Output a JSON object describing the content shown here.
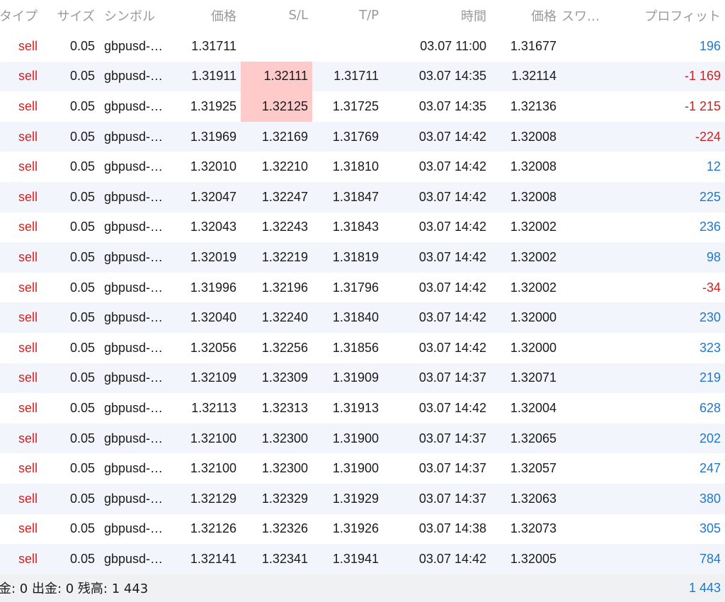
{
  "columns": {
    "type": "タイプ",
    "size": "サイズ",
    "symbol": "シンボル",
    "open_price": "価格",
    "sl": "S/L",
    "tp": "T/P",
    "time": "時間",
    "price": "価格",
    "swap": "スワ…",
    "profit": "プロフィット"
  },
  "rows": [
    {
      "type": "sell",
      "size": "0.05",
      "symbol": "gbpusd-…",
      "open_price": "1.31711",
      "sl": "",
      "tp": "",
      "time": "03.07 11:00",
      "price": "1.31677",
      "swap": "",
      "profit": "196",
      "profit_sign": "pos",
      "sl_hit": false
    },
    {
      "type": "sell",
      "size": "0.05",
      "symbol": "gbpusd-…",
      "open_price": "1.31911",
      "sl": "1.32111",
      "tp": "1.31711",
      "time": "03.07 14:35",
      "price": "1.32114",
      "swap": "",
      "profit": "-1 169",
      "profit_sign": "neg",
      "sl_hit": true
    },
    {
      "type": "sell",
      "size": "0.05",
      "symbol": "gbpusd-…",
      "open_price": "1.31925",
      "sl": "1.32125",
      "tp": "1.31725",
      "time": "03.07 14:35",
      "price": "1.32136",
      "swap": "",
      "profit": "-1 215",
      "profit_sign": "neg",
      "sl_hit": true
    },
    {
      "type": "sell",
      "size": "0.05",
      "symbol": "gbpusd-…",
      "open_price": "1.31969",
      "sl": "1.32169",
      "tp": "1.31769",
      "time": "03.07 14:42",
      "price": "1.32008",
      "swap": "",
      "profit": "-224",
      "profit_sign": "neg",
      "sl_hit": false
    },
    {
      "type": "sell",
      "size": "0.05",
      "symbol": "gbpusd-…",
      "open_price": "1.32010",
      "sl": "1.32210",
      "tp": "1.31810",
      "time": "03.07 14:42",
      "price": "1.32008",
      "swap": "",
      "profit": "12",
      "profit_sign": "pos",
      "sl_hit": false
    },
    {
      "type": "sell",
      "size": "0.05",
      "symbol": "gbpusd-…",
      "open_price": "1.32047",
      "sl": "1.32247",
      "tp": "1.31847",
      "time": "03.07 14:42",
      "price": "1.32008",
      "swap": "",
      "profit": "225",
      "profit_sign": "pos",
      "sl_hit": false
    },
    {
      "type": "sell",
      "size": "0.05",
      "symbol": "gbpusd-…",
      "open_price": "1.32043",
      "sl": "1.32243",
      "tp": "1.31843",
      "time": "03.07 14:42",
      "price": "1.32002",
      "swap": "",
      "profit": "236",
      "profit_sign": "pos",
      "sl_hit": false
    },
    {
      "type": "sell",
      "size": "0.05",
      "symbol": "gbpusd-…",
      "open_price": "1.32019",
      "sl": "1.32219",
      "tp": "1.31819",
      "time": "03.07 14:42",
      "price": "1.32002",
      "swap": "",
      "profit": "98",
      "profit_sign": "pos",
      "sl_hit": false
    },
    {
      "type": "sell",
      "size": "0.05",
      "symbol": "gbpusd-…",
      "open_price": "1.31996",
      "sl": "1.32196",
      "tp": "1.31796",
      "time": "03.07 14:42",
      "price": "1.32002",
      "swap": "",
      "profit": "-34",
      "profit_sign": "neg",
      "sl_hit": false
    },
    {
      "type": "sell",
      "size": "0.05",
      "symbol": "gbpusd-…",
      "open_price": "1.32040",
      "sl": "1.32240",
      "tp": "1.31840",
      "time": "03.07 14:42",
      "price": "1.32000",
      "swap": "",
      "profit": "230",
      "profit_sign": "pos",
      "sl_hit": false
    },
    {
      "type": "sell",
      "size": "0.05",
      "symbol": "gbpusd-…",
      "open_price": "1.32056",
      "sl": "1.32256",
      "tp": "1.31856",
      "time": "03.07 14:42",
      "price": "1.32000",
      "swap": "",
      "profit": "323",
      "profit_sign": "pos",
      "sl_hit": false
    },
    {
      "type": "sell",
      "size": "0.05",
      "symbol": "gbpusd-…",
      "open_price": "1.32109",
      "sl": "1.32309",
      "tp": "1.31909",
      "time": "03.07 14:37",
      "price": "1.32071",
      "swap": "",
      "profit": "219",
      "profit_sign": "pos",
      "sl_hit": false
    },
    {
      "type": "sell",
      "size": "0.05",
      "symbol": "gbpusd-…",
      "open_price": "1.32113",
      "sl": "1.32313",
      "tp": "1.31913",
      "time": "03.07 14:42",
      "price": "1.32004",
      "swap": "",
      "profit": "628",
      "profit_sign": "pos",
      "sl_hit": false
    },
    {
      "type": "sell",
      "size": "0.05",
      "symbol": "gbpusd-…",
      "open_price": "1.32100",
      "sl": "1.32300",
      "tp": "1.31900",
      "time": "03.07 14:37",
      "price": "1.32065",
      "swap": "",
      "profit": "202",
      "profit_sign": "pos",
      "sl_hit": false
    },
    {
      "type": "sell",
      "size": "0.05",
      "symbol": "gbpusd-…",
      "open_price": "1.32100",
      "sl": "1.32300",
      "tp": "1.31900",
      "time": "03.07 14:37",
      "price": "1.32057",
      "swap": "",
      "profit": "247",
      "profit_sign": "pos",
      "sl_hit": false
    },
    {
      "type": "sell",
      "size": "0.05",
      "symbol": "gbpusd-…",
      "open_price": "1.32129",
      "sl": "1.32329",
      "tp": "1.31929",
      "time": "03.07 14:37",
      "price": "1.32063",
      "swap": "",
      "profit": "380",
      "profit_sign": "pos",
      "sl_hit": false
    },
    {
      "type": "sell",
      "size": "0.05",
      "symbol": "gbpusd-…",
      "open_price": "1.32126",
      "sl": "1.32326",
      "tp": "1.31926",
      "time": "03.07 14:38",
      "price": "1.32073",
      "swap": "",
      "profit": "305",
      "profit_sign": "pos",
      "sl_hit": false
    },
    {
      "type": "sell",
      "size": "0.05",
      "symbol": "gbpusd-…",
      "open_price": "1.32141",
      "sl": "1.32341",
      "tp": "1.31941",
      "time": "03.07 14:42",
      "price": "1.32005",
      "swap": "",
      "profit": "784",
      "profit_sign": "pos",
      "sl_hit": false
    }
  ],
  "footer": {
    "summary": "金: 0 出金: 0 残高: 1 443",
    "total": "1 443"
  },
  "colors": {
    "sell": "#d41f1f",
    "profit_positive": "#1e78d2",
    "profit_negative": "#d41f1f",
    "sl_hit_highlight": "#ffcaca",
    "row_alt": "#f2f5fb",
    "header_text": "#9a9a9a",
    "footer_bg": "#f0f1f3"
  }
}
